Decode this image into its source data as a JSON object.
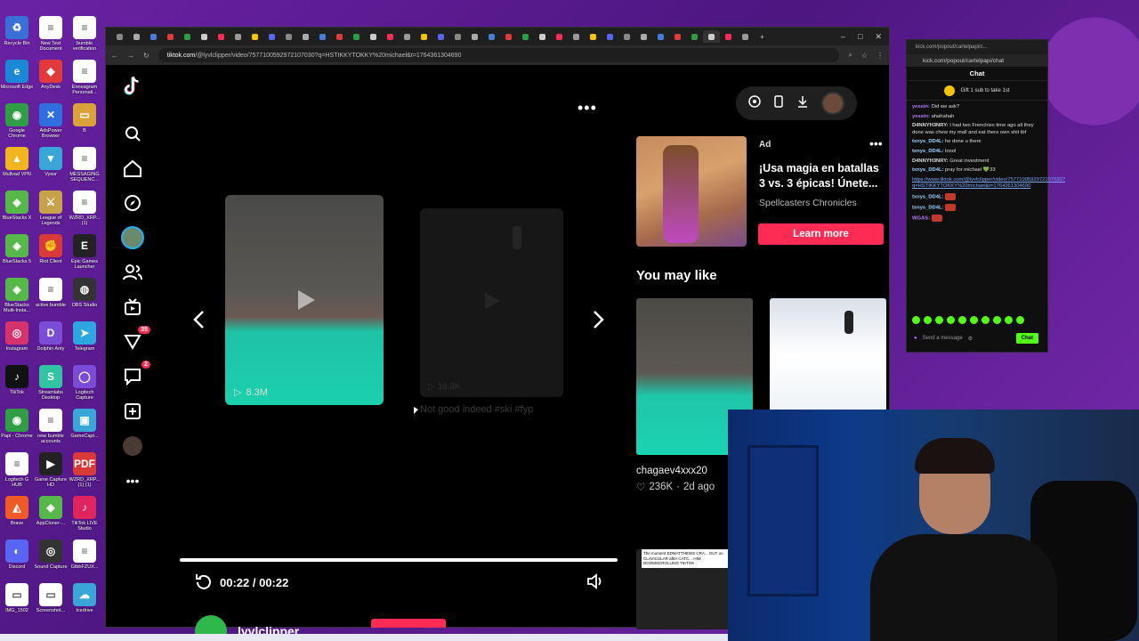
{
  "desktop": {
    "icons": [
      {
        "label": "Recycle Bin",
        "color": "#3a6fd8",
        "glyph": "♻"
      },
      {
        "label": "New Text Document",
        "color": "#ffffff",
        "glyph": "≡"
      },
      {
        "label": "bumble verification",
        "color": "#ffffff",
        "glyph": "≡"
      },
      {
        "label": "Microsoft Edge",
        "color": "#1b88d6",
        "glyph": "e"
      },
      {
        "label": "AnyDesk",
        "color": "#e03a3a",
        "glyph": "◆"
      },
      {
        "label": "Enneagram Personali...",
        "color": "#ffffff",
        "glyph": "≡"
      },
      {
        "label": "Google Chrome",
        "color": "#2f9e44",
        "glyph": "◉"
      },
      {
        "label": "AdsPower Browser",
        "color": "#2f6fe0",
        "glyph": "✕"
      },
      {
        "label": "B",
        "color": "#d9a23a",
        "glyph": "▭"
      },
      {
        "label": "Mullvad VPN",
        "color": "#f1b51d",
        "glyph": "▲"
      },
      {
        "label": "Vysor",
        "color": "#3aa6d8",
        "glyph": "▼"
      },
      {
        "label": "MESSAGING SEQUENC...",
        "color": "#ffffff",
        "glyph": "≡"
      },
      {
        "label": "BlueStacks X",
        "color": "#57b84a",
        "glyph": "◈"
      },
      {
        "label": "League of Legends",
        "color": "#c8a24a",
        "glyph": "⚔"
      },
      {
        "label": "WZRD_XRP... (1)",
        "color": "#ffffff",
        "glyph": "≡"
      },
      {
        "label": "BlueStacks 5",
        "color": "#57b84a",
        "glyph": "◈"
      },
      {
        "label": "Riot Client",
        "color": "#d83a3a",
        "glyph": "✊"
      },
      {
        "label": "Epic Games Launcher",
        "color": "#222222",
        "glyph": "E"
      },
      {
        "label": "BlueStacks Multi-Insta...",
        "color": "#57b84a",
        "glyph": "◈"
      },
      {
        "label": "active bumble",
        "color": "#ffffff",
        "glyph": "≡"
      },
      {
        "label": "OBS Studio",
        "color": "#333333",
        "glyph": "◍"
      },
      {
        "label": "Instagram",
        "color": "#d6336c",
        "glyph": "◎"
      },
      {
        "label": "Dolphin Anty",
        "color": "#7b4cd6",
        "glyph": "D"
      },
      {
        "label": "Telegram",
        "color": "#2ea6e0",
        "glyph": "➤"
      },
      {
        "label": "TikTok",
        "color": "#111111",
        "glyph": "♪"
      },
      {
        "label": "Streamlabs Desktop",
        "color": "#31c3a2",
        "glyph": "S"
      },
      {
        "label": "Logitech Capture",
        "color": "#7b4cd6",
        "glyph": "◯"
      },
      {
        "label": "Papi - Chrome",
        "color": "#2f9e44",
        "glyph": "◉"
      },
      {
        "label": "new bumble accounts",
        "color": "#ffffff",
        "glyph": "≡"
      },
      {
        "label": "GameCapt...",
        "color": "#3aa6d8",
        "glyph": "▣"
      },
      {
        "label": "Logitech G HUB",
        "color": "#ffffff",
        "glyph": "≡"
      },
      {
        "label": "Game Capture HD",
        "color": "#222222",
        "glyph": "▶"
      },
      {
        "label": "WZRD_XRP... (1) (1)",
        "color": "#d83a3a",
        "glyph": "PDF"
      },
      {
        "label": "Brave",
        "color": "#f05a28",
        "glyph": "◭"
      },
      {
        "label": "AppCloner-...",
        "color": "#57b84a",
        "glyph": "◈"
      },
      {
        "label": "TikTok LIVE Studio",
        "color": "#e0245e",
        "glyph": "♪"
      },
      {
        "label": "Discord",
        "color": "#5865f2",
        "glyph": "◐"
      },
      {
        "label": "Sound Capture",
        "color": "#333333",
        "glyph": "◎"
      },
      {
        "label": "GtbbFZUX...",
        "color": "#ffffff",
        "glyph": "≡"
      },
      {
        "label": "IMG_1502",
        "color": "#ffffff",
        "glyph": "▭"
      },
      {
        "label": "Screenshot...",
        "color": "#ffffff",
        "glyph": "▭"
      },
      {
        "label": "Icedrive",
        "color": "#3aa6d8",
        "glyph": "☁"
      }
    ]
  },
  "browser": {
    "url_domain": "tiktok.com",
    "url_rest": "/@lyvlclipper/video/7577100592972107030?q=HSTIKKYTOKKY%20michael&t=1764361304690",
    "tab_count": 38,
    "window_controls": [
      "–",
      "□",
      "✕"
    ]
  },
  "tiktok": {
    "nav": {
      "explore_badge": "35",
      "inbox_badge": "2"
    },
    "more_menu": "•••",
    "main_video": {
      "views": "8.3M"
    },
    "ghost_video": {
      "views": "10.3K",
      "caption": "Not good indeed #ski #fyp"
    },
    "player": {
      "time": "00:22 / 00:22",
      "progress": 1.0
    },
    "author": {
      "name": "lyvlclipper"
    },
    "ad": {
      "label": "Ad",
      "more": "•••",
      "title": "¡Usa magia en batallas 3 vs. 3 épicas! Únete...",
      "brand": "Spellcasters Chronicles",
      "cta": "Learn more"
    },
    "you_may_like": {
      "heading": "You may like",
      "item1_user": "chagaev4xxx20",
      "item1_likes": "236K",
      "item1_age": "2d ago",
      "item3_caption": "The moment EDMATTHEWS CRA... OUT on CLAVICULAR after CATC... HIM DOOMSCROLLING TIKTOK"
    }
  },
  "chat": {
    "window_title": "kick.com/popout/cartelpapi/c...",
    "url": "kick.com/popout/cartelpapi/chat",
    "heading": "Chat",
    "gift": "Gift 1 sub to take 1st",
    "messages": [
      {
        "user": "yessin:",
        "text": "Did we ask?",
        "cls": "u1"
      },
      {
        "user": "yessin:",
        "text": "ahahahah",
        "cls": "u1"
      },
      {
        "user": "D4NNYH3NRY:",
        "text": "I had two Frenchies time ago all they done was chew my mall and eat there own shit tbf",
        "cls": "u2"
      },
      {
        "user": "txnys_DD4L:",
        "text": "he done u there",
        "cls": "u3"
      },
      {
        "user": "txnys_DD4L:",
        "text": "loool",
        "cls": "u3"
      },
      {
        "user": "D4NNYH3NRY:",
        "text": "Great investment",
        "cls": "u2"
      },
      {
        "user": "txnys_DD4L:",
        "text": "pray for michael 💚33",
        "cls": "u3"
      },
      {
        "user": "",
        "text": "https://www.tiktok.com/@lyvlclipper/video/7577100592972107030?q=HSTIKKYTOKKY%20michael&t=1764361304690",
        "cls": "link"
      },
      {
        "user": "txnys_DD4L:",
        "text": "",
        "cls": "u3"
      },
      {
        "user": "txnys_DD4L:",
        "text": "",
        "cls": "u3"
      },
      {
        "user": "WGAS:",
        "text": "",
        "cls": "u1"
      }
    ],
    "input_placeholder": "Send a message",
    "send_label": "Chat"
  }
}
